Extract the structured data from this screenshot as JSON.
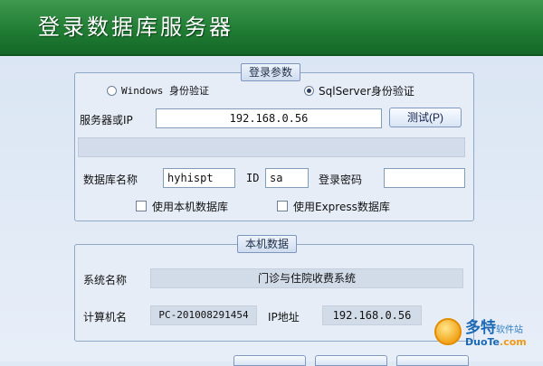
{
  "window": {
    "title": "登录数据库服务器"
  },
  "login_params": {
    "legend": "登录参数",
    "auth": {
      "windows_label": "Windows  身份验证",
      "sqlserver_label": "SqlServer身份验证",
      "selected": "sqlserver"
    },
    "server_label": "服务器或IP",
    "server_value": "192.168.0.56",
    "test_button": "测试(P)",
    "db_name_label": "数据库名称",
    "db_name_value": "hyhispt",
    "id_label": "ID",
    "id_value": "sa",
    "password_label": "登录密码",
    "password_value": "",
    "use_local_db_label": "使用本机数据库",
    "use_express_db_label": "使用Express数据库"
  },
  "local_data": {
    "legend": "本机数据",
    "system_name_label": "系统名称",
    "system_name_value": "门诊与住院收费系统",
    "computer_name_label": "计算机名",
    "computer_name_value": "PC-201008291454",
    "ip_label": "IP地址",
    "ip_value": "192.168.0.56"
  },
  "watermark": {
    "cn": "多特",
    "cn_small": "软件站",
    "en": "DuoTe",
    "en_suffix": ".com"
  }
}
